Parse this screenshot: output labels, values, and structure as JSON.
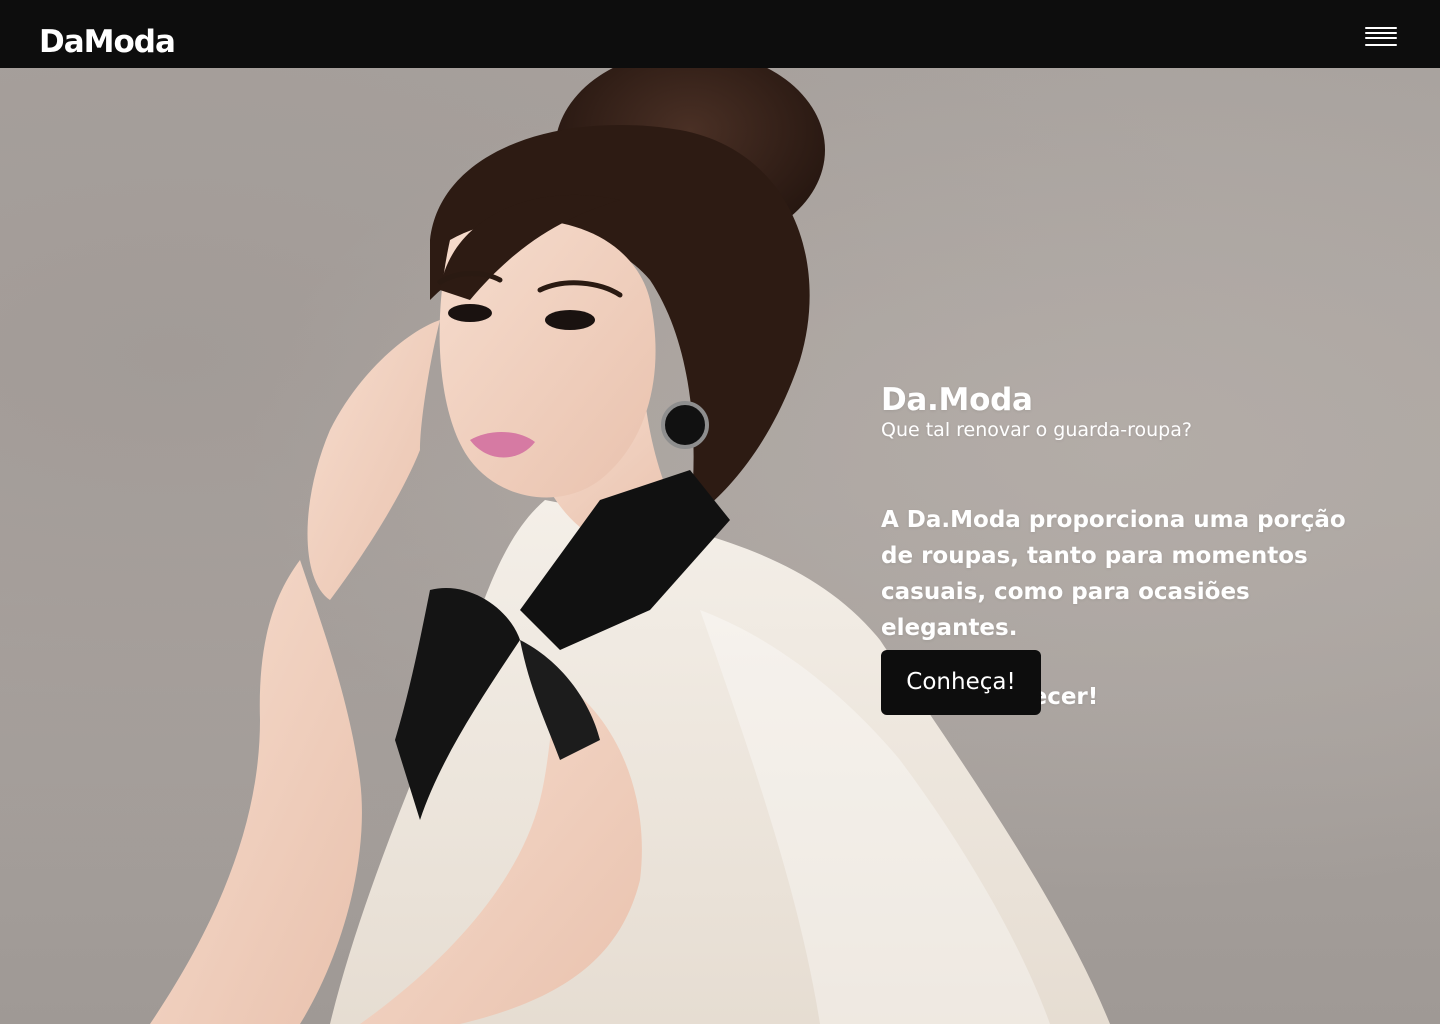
{
  "header": {
    "logo": "DaModa",
    "menu_icon": "hamburger-menu-icon"
  },
  "hero": {
    "image": "fashion-model-photo",
    "title": "Da.Moda",
    "subtitle": "Que tal renovar o guarda-roupa?",
    "description": "A Da.Moda proporciona uma porção de roupas, tanto para momentos casuais, como para ocasiões elegantes.",
    "cta_text": "Venha conhecer!",
    "cta_button": "Conheça!"
  },
  "colors": {
    "header_bg": "#0d0d0d",
    "button_bg": "#0d0d0d",
    "text": "#ffffff",
    "backdrop": "#a8a29e"
  }
}
